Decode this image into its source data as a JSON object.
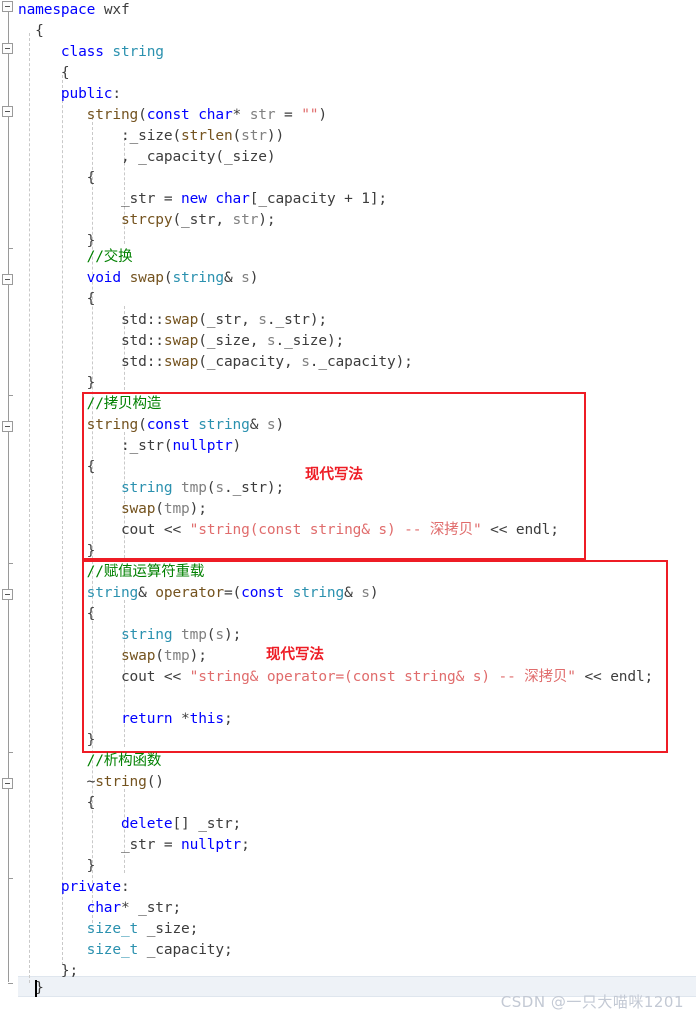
{
  "editor": {
    "language": "C++",
    "font_size_px": 14.5,
    "line_height_px": 21,
    "background": "#ffffff",
    "colors": {
      "keyword": "#0000ff",
      "type": "#2b91af",
      "comment": "#008000",
      "string": "#e06c6c",
      "function": "#74531f",
      "identifier": "#808080",
      "plain": "#3d3d3d",
      "annotation_red": "#ee1c25",
      "current_line": "#eef2f7",
      "watermark": "#c3c9d4"
    }
  },
  "lines": [
    {
      "n": 1,
      "indent": 0,
      "text": "namespace wxf"
    },
    {
      "n": 2,
      "indent": 1,
      "text": "{"
    },
    {
      "n": 3,
      "indent": 2,
      "text": "class string"
    },
    {
      "n": 4,
      "indent": 2,
      "text": "{"
    },
    {
      "n": 5,
      "indent": 2,
      "text": "public:"
    },
    {
      "n": 6,
      "indent": 3,
      "text": "string(const char* str = \"\")"
    },
    {
      "n": 7,
      "indent": 4,
      "text": ":_size(strlen(str))"
    },
    {
      "n": 8,
      "indent": 4,
      "text": ", _capacity(_size)"
    },
    {
      "n": 9,
      "indent": 3,
      "text": "{"
    },
    {
      "n": 10,
      "indent": 4,
      "text": "_str = new char[_capacity + 1];"
    },
    {
      "n": 11,
      "indent": 4,
      "text": "strcpy(_str, str);"
    },
    {
      "n": 12,
      "indent": 3,
      "text": "}"
    },
    {
      "n": 13,
      "indent": 3,
      "text": "//交换"
    },
    {
      "n": 14,
      "indent": 3,
      "text": "void swap(string& s)"
    },
    {
      "n": 15,
      "indent": 3,
      "text": "{"
    },
    {
      "n": 16,
      "indent": 4,
      "text": "std::swap(_str, s._str);"
    },
    {
      "n": 17,
      "indent": 4,
      "text": "std::swap(_size, s._size);"
    },
    {
      "n": 18,
      "indent": 4,
      "text": "std::swap(_capacity, s._capacity);"
    },
    {
      "n": 19,
      "indent": 3,
      "text": "}"
    },
    {
      "n": 20,
      "indent": 3,
      "text": "//拷贝构造"
    },
    {
      "n": 21,
      "indent": 3,
      "text": "string(const string& s)"
    },
    {
      "n": 22,
      "indent": 4,
      "text": ":_str(nullptr)"
    },
    {
      "n": 23,
      "indent": 3,
      "text": "{"
    },
    {
      "n": 24,
      "indent": 4,
      "text": "string tmp(s._str);"
    },
    {
      "n": 25,
      "indent": 4,
      "text": "swap(tmp);"
    },
    {
      "n": 26,
      "indent": 4,
      "text": "cout << \"string(const string& s) -- 深拷贝\" << endl;"
    },
    {
      "n": 27,
      "indent": 3,
      "text": "}"
    },
    {
      "n": 28,
      "indent": 3,
      "text": "//赋值运算符重载"
    },
    {
      "n": 29,
      "indent": 3,
      "text": "string& operator=(const string& s)"
    },
    {
      "n": 30,
      "indent": 3,
      "text": "{"
    },
    {
      "n": 31,
      "indent": 4,
      "text": "string tmp(s);"
    },
    {
      "n": 32,
      "indent": 4,
      "text": "swap(tmp);"
    },
    {
      "n": 33,
      "indent": 4,
      "text": "cout << \"string& operator=(const string& s) -- 深拷贝\" << endl;"
    },
    {
      "n": 34,
      "indent": 4,
      "text": ""
    },
    {
      "n": 35,
      "indent": 4,
      "text": "return *this;"
    },
    {
      "n": 36,
      "indent": 3,
      "text": "}"
    },
    {
      "n": 37,
      "indent": 3,
      "text": "//析构函数"
    },
    {
      "n": 38,
      "indent": 3,
      "text": "~string()"
    },
    {
      "n": 39,
      "indent": 3,
      "text": "{"
    },
    {
      "n": 40,
      "indent": 4,
      "text": "delete[] _str;"
    },
    {
      "n": 41,
      "indent": 4,
      "text": "_str = nullptr;"
    },
    {
      "n": 42,
      "indent": 3,
      "text": "}"
    },
    {
      "n": 43,
      "indent": 2,
      "text": "private:"
    },
    {
      "n": 44,
      "indent": 3,
      "text": "char* _str;"
    },
    {
      "n": 45,
      "indent": 3,
      "text": "size_t _size;"
    },
    {
      "n": 46,
      "indent": 3,
      "text": "size_t _capacity;"
    },
    {
      "n": 47,
      "indent": 2,
      "text": "};"
    },
    {
      "n": 48,
      "indent": 1,
      "text": "}"
    }
  ],
  "annotations": {
    "box1": {
      "label": "copy-constructor-highlight-box",
      "note": "现代写法",
      "color": "#ee1c25"
    },
    "box2": {
      "label": "assignment-operator-highlight-box",
      "note": "现代写法",
      "color": "#ee1c25"
    }
  },
  "watermark": {
    "text": "CSDN @一只大喵咪1201"
  },
  "fold_markers": {
    "expanded_glyph": "−",
    "count": 7
  }
}
